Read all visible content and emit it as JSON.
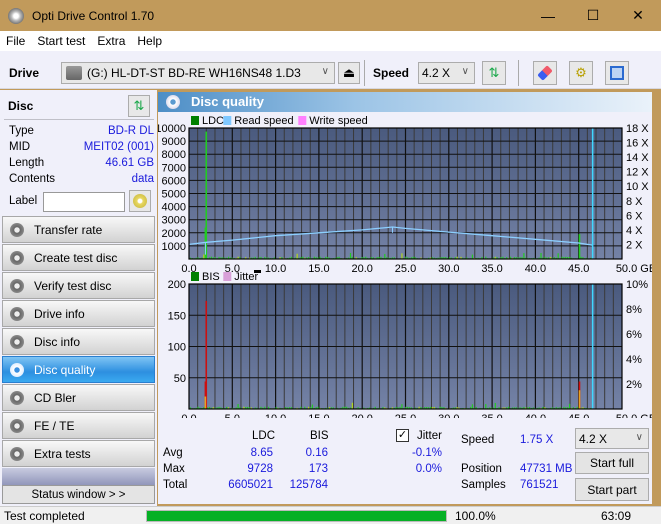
{
  "window": {
    "title": "Opti Drive Control 1.70",
    "minimize": "—",
    "maximize": "☐",
    "close": "✕"
  },
  "menu": [
    "File",
    "Start test",
    "Extra",
    "Help"
  ],
  "toolbar": {
    "drive_label": "Drive",
    "drive_value": "(G:)  HL-DT-ST BD-RE  WH16NS48 1.D3",
    "speed_label": "Speed",
    "speed_value": "4.2 X"
  },
  "disc": {
    "header": "Disc",
    "rows": [
      {
        "label": "Type",
        "value": "BD-R DL"
      },
      {
        "label": "MID",
        "value": "MEIT02 (001)"
      },
      {
        "label": "Length",
        "value": "46.61 GB"
      },
      {
        "label": "Contents",
        "value": "data"
      }
    ],
    "label_field": "Label",
    "label_value": ""
  },
  "nav": [
    {
      "label": "Transfer rate",
      "active": false
    },
    {
      "label": "Create test disc",
      "active": false
    },
    {
      "label": "Verify test disc",
      "active": false
    },
    {
      "label": "Drive info",
      "active": false
    },
    {
      "label": "Disc info",
      "active": false
    },
    {
      "label": "Disc quality",
      "active": true
    },
    {
      "label": "CD Bler",
      "active": false
    },
    {
      "label": "FE / TE",
      "active": false
    },
    {
      "label": "Extra tests",
      "active": false
    }
  ],
  "status_window_button": "Status window > >",
  "panel_title": "Disc quality",
  "chart_data": [
    {
      "type": "bar",
      "title": "LDC / Read speed",
      "legend": [
        {
          "name": "LDC",
          "color": "#008000"
        },
        {
          "name": "Read speed",
          "color": "#80c8ff"
        },
        {
          "name": "Write speed",
          "color": "#ff80ff"
        }
      ],
      "legend_placement": "top-left",
      "x_ticks": [
        "0.0",
        "5.0",
        "10.0",
        "15.0",
        "20.0",
        "25.0",
        "30.0",
        "35.0",
        "40.0",
        "45.0",
        "50.0 GB"
      ],
      "xlim": [
        0,
        50
      ],
      "y_ticks": [
        "1000",
        "2000",
        "3000",
        "4000",
        "5000",
        "6000",
        "7000",
        "8000",
        "9000",
        "10000"
      ],
      "ylim": [
        0,
        10000
      ],
      "y2_ticks": [
        "2 X",
        "4 X",
        "6 X",
        "8 X",
        "10 X",
        "12 X",
        "14 X",
        "16 X",
        "18 X"
      ],
      "y2lim": [
        0,
        18
      ],
      "grid": true,
      "end_marker_gb": 46.61,
      "ldc_spikes": [
        {
          "x": 1.9,
          "value": 9728
        },
        {
          "x": 1.8,
          "value": 2400
        },
        {
          "x": 45.0,
          "value": 1900
        }
      ],
      "ldc_baseline_approx": 150,
      "read_speed": {
        "x": [
          0,
          2,
          5,
          10,
          15,
          20,
          23.5,
          25,
          30,
          35,
          40,
          45,
          46.6
        ],
        "y": [
          2.0,
          2.3,
          2.6,
          3.2,
          3.6,
          4.0,
          4.4,
          4.2,
          3.7,
          3.2,
          2.7,
          2.2,
          1.9
        ]
      }
    },
    {
      "type": "bar",
      "title": "BIS / Jitter",
      "legend": [
        {
          "name": "BIS",
          "color": "#008000"
        },
        {
          "name": "Jitter",
          "color": "#d8a0d8"
        }
      ],
      "legend_placement": "top-left",
      "x_ticks": [
        "0.0",
        "5.0",
        "10.0",
        "15.0",
        "20.0",
        "25.0",
        "30.0",
        "35.0",
        "40.0",
        "45.0",
        "50.0 GB"
      ],
      "xlim": [
        0,
        50
      ],
      "y_ticks": [
        "50",
        "100",
        "150",
        "200"
      ],
      "ylim": [
        0,
        200
      ],
      "y2_ticks": [
        "2%",
        "4%",
        "6%",
        "8%",
        "10%"
      ],
      "y2lim": [
        0,
        10
      ],
      "grid": true,
      "end_marker_gb": 46.61,
      "bis_spikes": [
        {
          "x": 1.9,
          "value": 173
        },
        {
          "x": 1.8,
          "value": 44
        },
        {
          "x": 45.0,
          "value": 44
        }
      ],
      "bis_baseline_approx": 3
    }
  ],
  "stats": {
    "col_ldc": "LDC",
    "col_bis": "BIS",
    "jitter_label": "Jitter",
    "jitter_checked": true,
    "rows": [
      {
        "label": "Avg",
        "ldc": "8.65",
        "bis": "0.16",
        "jitter": "-0.1%"
      },
      {
        "label": "Max",
        "ldc": "9728",
        "bis": "173",
        "jitter": "0.0%"
      },
      {
        "label": "Total",
        "ldc": "6605021",
        "bis": "125784",
        "jitter": ""
      }
    ],
    "speed_label": "Speed",
    "speed_value": "1.75 X",
    "position_label": "Position",
    "position_value": "47731 MB",
    "samples_label": "Samples",
    "samples_value": "761521",
    "speed_select": "4.2 X",
    "start_full": "Start full",
    "start_part": "Start part"
  },
  "statusbar": {
    "text": "Test completed",
    "progress_percent": 100,
    "progress_text": "100.0%",
    "time": "63:09"
  },
  "colors": {
    "titlebar": "#c19a5b",
    "accent": "#2d8fe0",
    "progress": "#06b025",
    "value_text": "#1a1adc"
  }
}
